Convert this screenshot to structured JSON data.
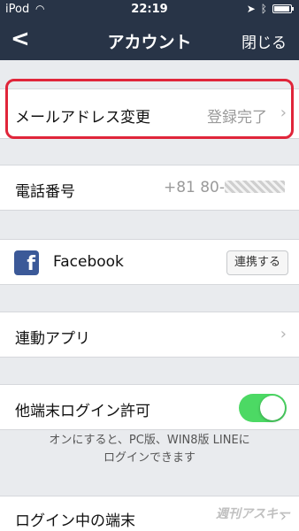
{
  "statusbar": {
    "carrier": "iPod",
    "time": "22:19"
  },
  "navbar": {
    "back_glyph": "<",
    "title": "アカウント",
    "close_label": "閉じる"
  },
  "email_row": {
    "label": "メールアドレス変更",
    "status": "登録完了"
  },
  "phone_row": {
    "label": "電話番号",
    "value_prefix": "+81 80-"
  },
  "facebook_row": {
    "icon_letter": "f",
    "label": "Facebook",
    "button_label": "連携する"
  },
  "linked_apps_row": {
    "label": "連動アプリ"
  },
  "other_login_row": {
    "label": "他端末ログイン許可",
    "toggle_on": true
  },
  "other_login_note": {
    "line1": "オンにすると、PC版、WIN8版 LINEに",
    "line2": "ログインできます"
  },
  "logged_in_devices_row": {
    "label": "ログイン中の端末"
  },
  "watermark": {
    "text": "週刊アスキー"
  },
  "colors": {
    "navbar_bg": "#283447",
    "toggle_on": "#4cd964",
    "highlight_border": "#e0253a",
    "facebook_blue": "#3b5998"
  },
  "icons": {
    "back": "chevron-left-icon",
    "chevron": "chevron-right-icon",
    "wifi": "wifi-icon",
    "location": "location-icon",
    "bluetooth": "bluetooth-icon",
    "battery": "battery-icon"
  }
}
